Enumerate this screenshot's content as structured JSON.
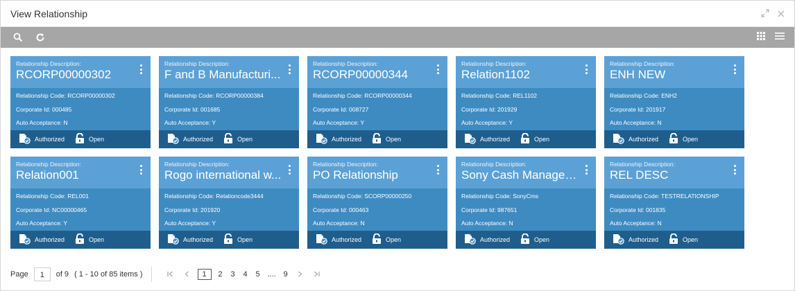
{
  "window": {
    "title": "View Relationship"
  },
  "cards": [
    {
      "desc_label": "Relationship Description:",
      "description": "RCORP00000302",
      "code_label": "Relationship Code:",
      "code": "RCORP00000302",
      "corp_label": "Corporate Id:",
      "corp": "000485",
      "auto_label": "Auto Acceptance:",
      "auto": "N",
      "status1": "Authorized",
      "status2": "Open"
    },
    {
      "desc_label": "Relationship Description:",
      "description": "F and B Manufacturi...",
      "code_label": "Relationship Code:",
      "code": "RCORP00000384",
      "corp_label": "Corporate Id:",
      "corp": "001685",
      "auto_label": "Auto Acceptance:",
      "auto": "Y",
      "status1": "Authorized",
      "status2": "Open"
    },
    {
      "desc_label": "Relationship Description:",
      "description": "RCORP00000344",
      "code_label": "Relationship Code:",
      "code": "RCORP00000344",
      "corp_label": "Corporate Id:",
      "corp": "008727",
      "auto_label": "Auto Acceptance:",
      "auto": "Y",
      "status1": "Authorized",
      "status2": "Open"
    },
    {
      "desc_label": "Relationship Description:",
      "description": "Relation1102",
      "code_label": "Relationship Code:",
      "code": "REL1102",
      "corp_label": "Corporate Id:",
      "corp": "201929",
      "auto_label": "Auto Acceptance:",
      "auto": "Y",
      "status1": "Authorized",
      "status2": "Open"
    },
    {
      "desc_label": "Relationship Description:",
      "description": "ENH NEW",
      "code_label": "Relationship Code:",
      "code": "ENH2",
      "corp_label": "Corporate Id:",
      "corp": "201917",
      "auto_label": "Auto Acceptance:",
      "auto": "N",
      "status1": "Authorized",
      "status2": "Open"
    },
    {
      "desc_label": "Relationship Description:",
      "description": "Relation001",
      "code_label": "Relationship Code:",
      "code": "REL001",
      "corp_label": "Corporate Id:",
      "corp": "NC00000465",
      "auto_label": "Auto Acceptance:",
      "auto": "Y",
      "status1": "Authorized",
      "status2": "Open"
    },
    {
      "desc_label": "Relationship Description:",
      "description": "Rogo international w...",
      "code_label": "Relationship Code:",
      "code": "Relationcode3444",
      "corp_label": "Corporate Id:",
      "corp": "201920",
      "auto_label": "Auto Acceptance:",
      "auto": "Y",
      "status1": "Authorized",
      "status2": "Open"
    },
    {
      "desc_label": "Relationship Description:",
      "description": "PO Relationship",
      "code_label": "Relationship Code:",
      "code": "SCORP00000250",
      "corp_label": "Corporate Id:",
      "corp": "000463",
      "auto_label": "Auto Acceptance:",
      "auto": "N",
      "status1": "Authorized",
      "status2": "Open"
    },
    {
      "desc_label": "Relationship Description:",
      "description": "Sony Cash Managem...",
      "code_label": "Relationship Code:",
      "code": "SonyCms",
      "corp_label": "Corporate Id:",
      "corp": "987651",
      "auto_label": "Auto Acceptance:",
      "auto": "N",
      "status1": "Authorized",
      "status2": "Open"
    },
    {
      "desc_label": "Relationship Description:",
      "description": "REL DESC",
      "code_label": "Relationship Code:",
      "code": "TESTRELATIONSHIP",
      "corp_label": "Corporate Id:",
      "corp": "001835",
      "auto_label": "Auto Acceptance:",
      "auto": "N",
      "status1": "Authorized",
      "status2": "Open"
    }
  ],
  "pagination": {
    "page_label": "Page",
    "current": "1",
    "of_label": "of 9",
    "items_label": "( 1 - 10 of 85 items )",
    "pages": [
      "1",
      "2",
      "3",
      "4",
      "5",
      "....",
      "9"
    ]
  },
  "colors": {
    "card_top": "#5ba1d6",
    "card_mid": "#3e8bc2",
    "card_bottom": "#1f5e8c",
    "toolbar": "#a6a6a6"
  }
}
